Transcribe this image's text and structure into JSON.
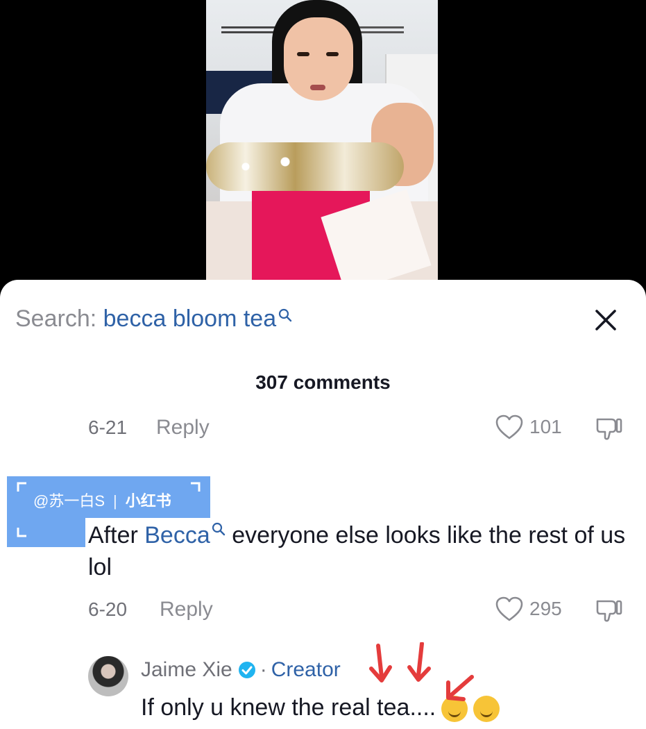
{
  "search": {
    "prefix": "Search:",
    "term": "becca bloom tea"
  },
  "comments_count": "307 comments",
  "comment1_meta": {
    "date": "6-21",
    "reply_label": "Reply",
    "likes": "101"
  },
  "watermark": {
    "handle": "@苏一白S",
    "separator": "|",
    "logo": "小红书"
  },
  "comment2": {
    "before": "After ",
    "mention": "Becca",
    "after": " everyone else looks like the rest of us lol",
    "date": "6-20",
    "reply_label": "Reply",
    "likes": "295"
  },
  "creator_reply": {
    "author": "Jaime Xie",
    "separator": "·",
    "badge": "Creator",
    "text": "If only u knew the real tea...."
  },
  "colors": {
    "accent": "#2f62a7",
    "watermark": "#6fa7f0",
    "arrows": "#e43c3c"
  },
  "icons": [
    "search-icon",
    "close-icon",
    "heart-icon",
    "dislike-icon",
    "verified-icon",
    "arrow-annotation",
    "shushing-emoji",
    "upside-down-emoji"
  ]
}
